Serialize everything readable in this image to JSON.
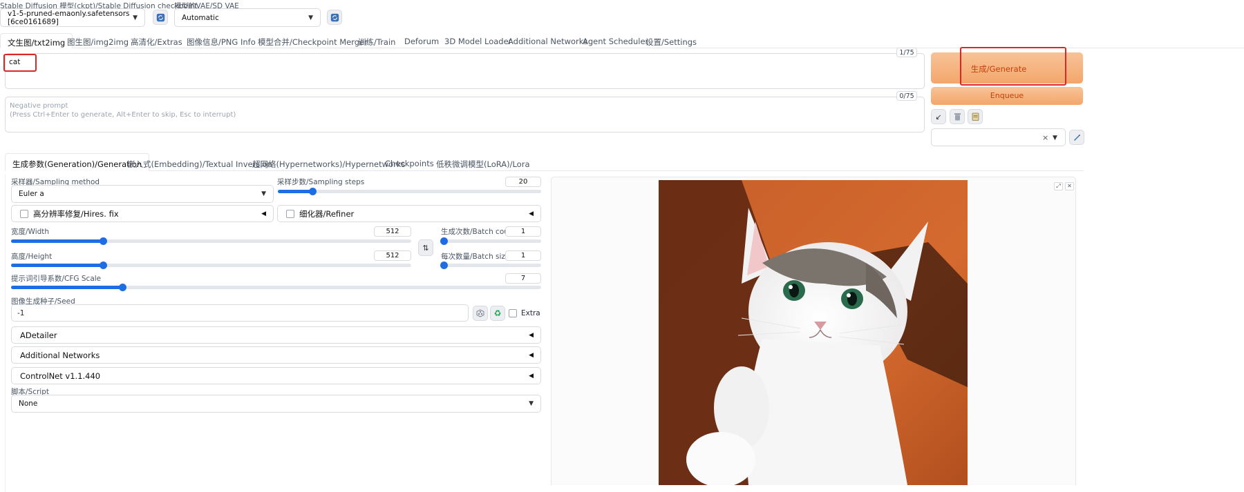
{
  "top": {
    "checkpoint_label": "Stable Diffusion 模型(ckpt)/Stable Diffusion checkpoint",
    "checkpoint_value": "v1-5-pruned-emaonly.safetensors [6ce0161689]",
    "vae_label": "模型的VAE/SD VAE",
    "vae_value": "Automatic"
  },
  "tabs": [
    "文生图/txt2img",
    "图生图/img2img",
    "高清化/Extras",
    "图像信息/PNG Info",
    "模型合并/Checkpoint Merger",
    "训练/Train",
    "Deforum",
    "3D Model Loader",
    "Additional Networks",
    "Agent Scheduler",
    "设置/Settings"
  ],
  "prompt": {
    "value": "cat",
    "counter": "1/75",
    "negative_placeholder": "Negative prompt\n(Press Ctrl+Enter to generate, Alt+Enter to skip, Esc to interrupt)",
    "negative_counter": "0/75"
  },
  "actions": {
    "generate": "生成/Generate",
    "enqueue": "Enqueue",
    "styles_clear": "×"
  },
  "subtabs": [
    "生成参数(Generation)/Generation",
    "嵌入式(Embedding)/Textual Inversion",
    "超网络(Hypernetworks)/Hypernetworks",
    "Checkpoints",
    "低秩微调模型(LoRA)/Lora"
  ],
  "params": {
    "sampling_method_label": "采样器/Sampling method",
    "sampling_method_value": "Euler a",
    "sampling_steps_label": "采样步数/Sampling steps",
    "sampling_steps_value": "20",
    "sampling_steps_fraction": 0.13,
    "hires_label": "高分辨率修复/Hires. fix",
    "refiner_label": "细化器/Refiner",
    "width_label": "宽度/Width",
    "width_value": "512",
    "width_fraction": 0.23,
    "height_label": "高度/Height",
    "height_value": "512",
    "height_fraction": 0.23,
    "batch_count_label": "生成次数/Batch count",
    "batch_count_value": "1",
    "batch_count_fraction": 0.0,
    "batch_size_label": "每次数量/Batch size",
    "batch_size_value": "1",
    "batch_size_fraction": 0.0,
    "cfg_label": "提示词引导系数/CFG Scale",
    "cfg_value": "7",
    "cfg_fraction": 0.21,
    "seed_label": "图像生成种子/Seed",
    "seed_value": "-1",
    "extra_label": "Extra",
    "adetailer": "ADetailer",
    "additional_networks": "Additional Networks",
    "controlnet": "ControlNet v1.1.440",
    "script_label": "脚本/Script",
    "script_value": "None"
  },
  "colors": {
    "accent_orange": "#f3b07b",
    "accent_orange_dark": "#e8894a",
    "slider_blue": "#1e6de5",
    "highlight_red": "#dc2626"
  }
}
